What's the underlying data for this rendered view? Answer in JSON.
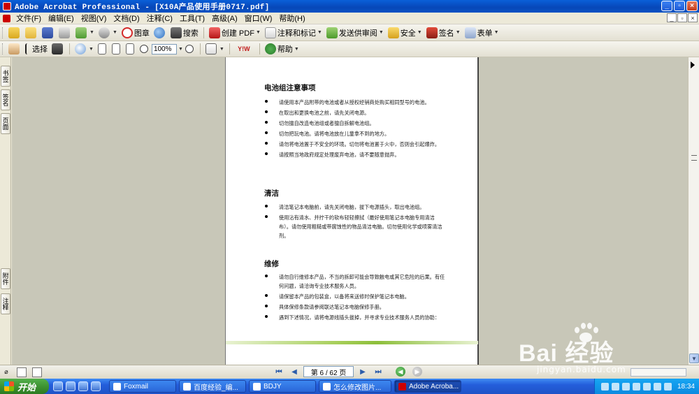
{
  "window": {
    "title": "Adobe Acrobat Professional - [X10A产品使用手册0717.pdf]",
    "min_symbol": "_",
    "max_symbol": "▫",
    "close_symbol": "×"
  },
  "menu": [
    "文件(F)",
    "编辑(E)",
    "视图(V)",
    "文档(D)",
    "注释(C)",
    "工具(T)",
    "高级(A)",
    "窗口(W)",
    "帮助(H)"
  ],
  "toolbar1": {
    "stamp_label": "图章",
    "search_label": "搜索",
    "create_pdf_label": "创建 PDF",
    "comment_label": "注释和标记",
    "send_review_label": "发送供审阅",
    "security_label": "安全",
    "sign_label": "签名",
    "forms_label": "表单"
  },
  "toolbar2": {
    "select_label": "选择",
    "zoom_value": "100%",
    "help_label": "帮助",
    "logo_text": "Y!W"
  },
  "nav_tabs": {
    "bookmarks": "书签",
    "signatures": "签名",
    "pages": "页面",
    "attachments": "附件",
    "comments": "注释"
  },
  "document": {
    "sections": [
      {
        "title": "电池组注意事项",
        "items": [
          "请使用本产品附带的电池或者从授权经销商处购买相同型号的电池。",
          "在取出和更换电池之前，请先关闭电源。",
          "切勿擅自改造电池组或者擅自拆解电池组。",
          "切勿把玩电池。请将电池放在儿童拿不到的地方。",
          "请勿将电池置于不安全的环境。切勿将电池置于火中，否则会引起爆炸。",
          "请按照当地政府规定处理废弃电池，请不要随意抛弃。"
        ]
      },
      {
        "title": "清洁",
        "items": [
          "清洁笔记本电脑前，请先关闭电脑，拔下电源插头，取出电池组。",
          "使用沾有清水、并拧干的软布轻轻擦拭（最好使用笔记本电脑专用清洁布）。请勿使用粗糙或带腐蚀性的物品清洁电脑。切勿使用化学或喷雾清洁剂。"
        ]
      },
      {
        "title": "维修",
        "items": [
          "请勿自行维修本产品，不当的拆卸可能会导致触电或其它危险的后果。有任何问题，请洽询专业技术服务人员。",
          "请保留本产品的包装盒，以备将来送修时保护笔记本电脑。",
          "具体保修条款请参阅联达笔记本电脑保修手册。",
          "遇到下述情况，请将电源线插头拔掉，并寻求专业技术服务人员的协助："
        ]
      }
    ]
  },
  "statusbar": {
    "page_indicator": "第 6 / 62 页"
  },
  "taskbar": {
    "start_label": "开始",
    "tasks": [
      "Foxmail",
      "百度经验_编...",
      "BDJY",
      "怎么修改图片...",
      "Adobe Acroba..."
    ],
    "clock": "18:34"
  },
  "watermark": {
    "brand": "Bai 经验",
    "url": "jingyan.baidu.com"
  }
}
